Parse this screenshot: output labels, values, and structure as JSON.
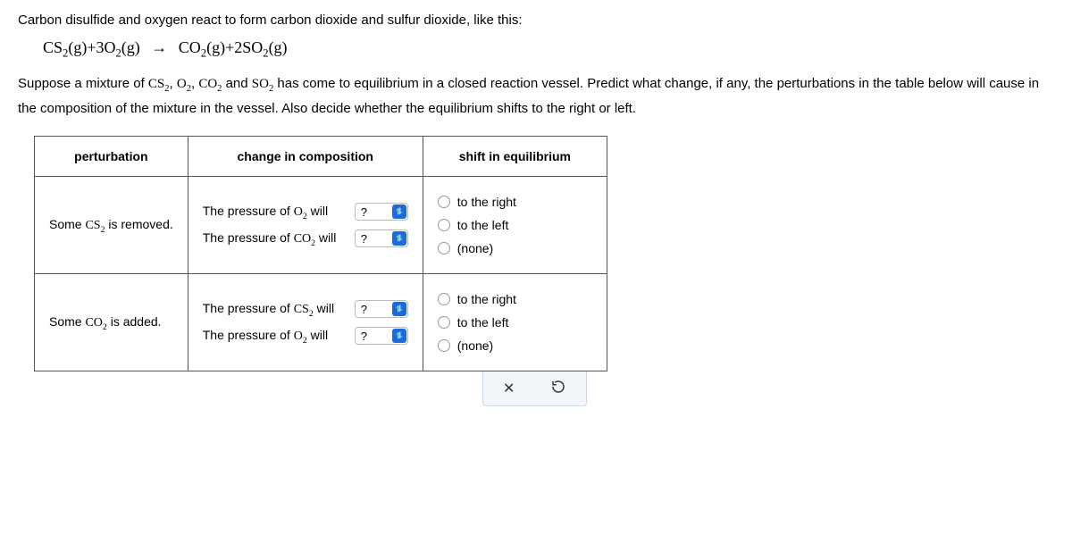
{
  "intro": "Carbon disulfide and oxygen react to form carbon dioxide and sulfur dioxide, like this:",
  "equation": {
    "lhs_a": "CS",
    "lhs_a_sub": "2",
    "lhs_a_state": "(g)",
    "plus1": "+",
    "lhs_b_coef": "3",
    "lhs_b": "O",
    "lhs_b_sub": "2",
    "lhs_b_state": "(g)",
    "arrow": "→",
    "rhs_a": "CO",
    "rhs_a_sub": "2",
    "rhs_a_state": "(g)",
    "plus2": "+",
    "rhs_b_coef": "2",
    "rhs_b": "SO",
    "rhs_b_sub": "2",
    "rhs_b_state": "(g)"
  },
  "prompt_a": "Suppose a mixture of ",
  "species": {
    "a": "CS",
    "a_sub": "2",
    "b": "O",
    "b_sub": "2",
    "c": "CO",
    "c_sub": "2",
    "d": "SO",
    "d_sub": "2"
  },
  "sep": ", ",
  "and": " and ",
  "prompt_b": " has come to equilibrium in a closed reaction vessel. Predict what change, if any, the perturbations in the table below will cause in the composition of the mixture in the vessel. Also decide whether the equilibrium shifts to the right or left.",
  "headers": {
    "perturbation": "perturbation",
    "change": "change in composition",
    "shift": "shift in equilibrium"
  },
  "rows": [
    {
      "perturbation_pre": "Some ",
      "perturbation_chem": "CS",
      "perturbation_sub": "2",
      "perturbation_post": " is removed.",
      "comp1_pre": "The pressure of ",
      "comp1_chem": "O",
      "comp1_sub": "2",
      "comp1_post": " will",
      "comp2_pre": "The pressure of ",
      "comp2_chem": "CO",
      "comp2_sub": "2",
      "comp2_post": " will"
    },
    {
      "perturbation_pre": "Some ",
      "perturbation_chem": "CO",
      "perturbation_sub": "2",
      "perturbation_post": " is added.",
      "comp1_pre": "The pressure of ",
      "comp1_chem": "CS",
      "comp1_sub": "2",
      "comp1_post": " will",
      "comp2_pre": "The pressure of ",
      "comp2_chem": "O",
      "comp2_sub": "2",
      "comp2_post": " will"
    }
  ],
  "select_placeholder": "?",
  "shift_options": {
    "right": "to the right",
    "left": "to the left",
    "none": "(none)"
  },
  "actions": {
    "close": "✕"
  }
}
